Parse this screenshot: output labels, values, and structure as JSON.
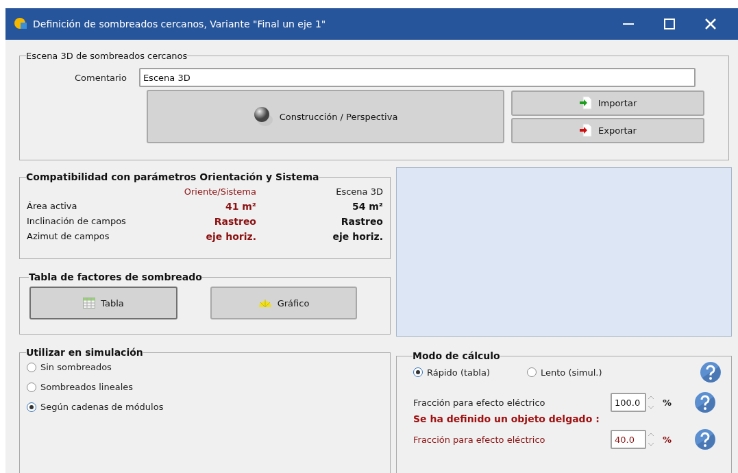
{
  "window": {
    "title": "Definición de sombreados cercanos, Variante \"Final un eje 1\""
  },
  "scene": {
    "title": "Escena 3D de sombreados cercanos",
    "comment_label": "Comentario",
    "comment_value": "Escena 3D",
    "build_button": "Construcción / Perspectiva",
    "import_button": "Importar",
    "export_button": "Exportar"
  },
  "compat": {
    "title": "Compatibilidad con parámetros Orientación y Sistema",
    "columns": [
      "Oriente/Sistema",
      "Escena 3D"
    ],
    "rows": [
      {
        "label": "Área activa",
        "values": [
          "41 m²",
          "54 m²"
        ]
      },
      {
        "label": "Inclinación de campos",
        "values": [
          "Rastreo",
          "Rastreo"
        ]
      },
      {
        "label": "Azimut de campos",
        "values": [
          "eje horiz.",
          "eje horiz."
        ]
      }
    ]
  },
  "factors": {
    "title": "Tabla de factores de sombreado",
    "buttons": [
      {
        "kind": "table",
        "label": "Tabla",
        "default": true
      },
      {
        "kind": "chart",
        "label": "Gráfico",
        "default": false
      }
    ]
  },
  "usage": {
    "title": "Utilizar en simulación",
    "options": [
      {
        "label": "Sin sombreados",
        "selected": false
      },
      {
        "label": "Sombreados lineales",
        "selected": false
      },
      {
        "label": "Según cadenas de módulos",
        "selected": true
      }
    ]
  },
  "mode": {
    "title": "Modo de cálculo",
    "options": [
      {
        "label": "Rápido (tabla)",
        "selected": true
      },
      {
        "label": "Lento (simul.)",
        "selected": false
      }
    ],
    "fraction": {
      "label": "Fracción para efecto eléctrico",
      "value": "100.0",
      "unit": "%"
    },
    "notice": "Se ha definido un objeto delgado :",
    "thin_fraction": {
      "label": "Fracción para efecto eléctrico",
      "value": "40.0",
      "unit": "%"
    }
  }
}
